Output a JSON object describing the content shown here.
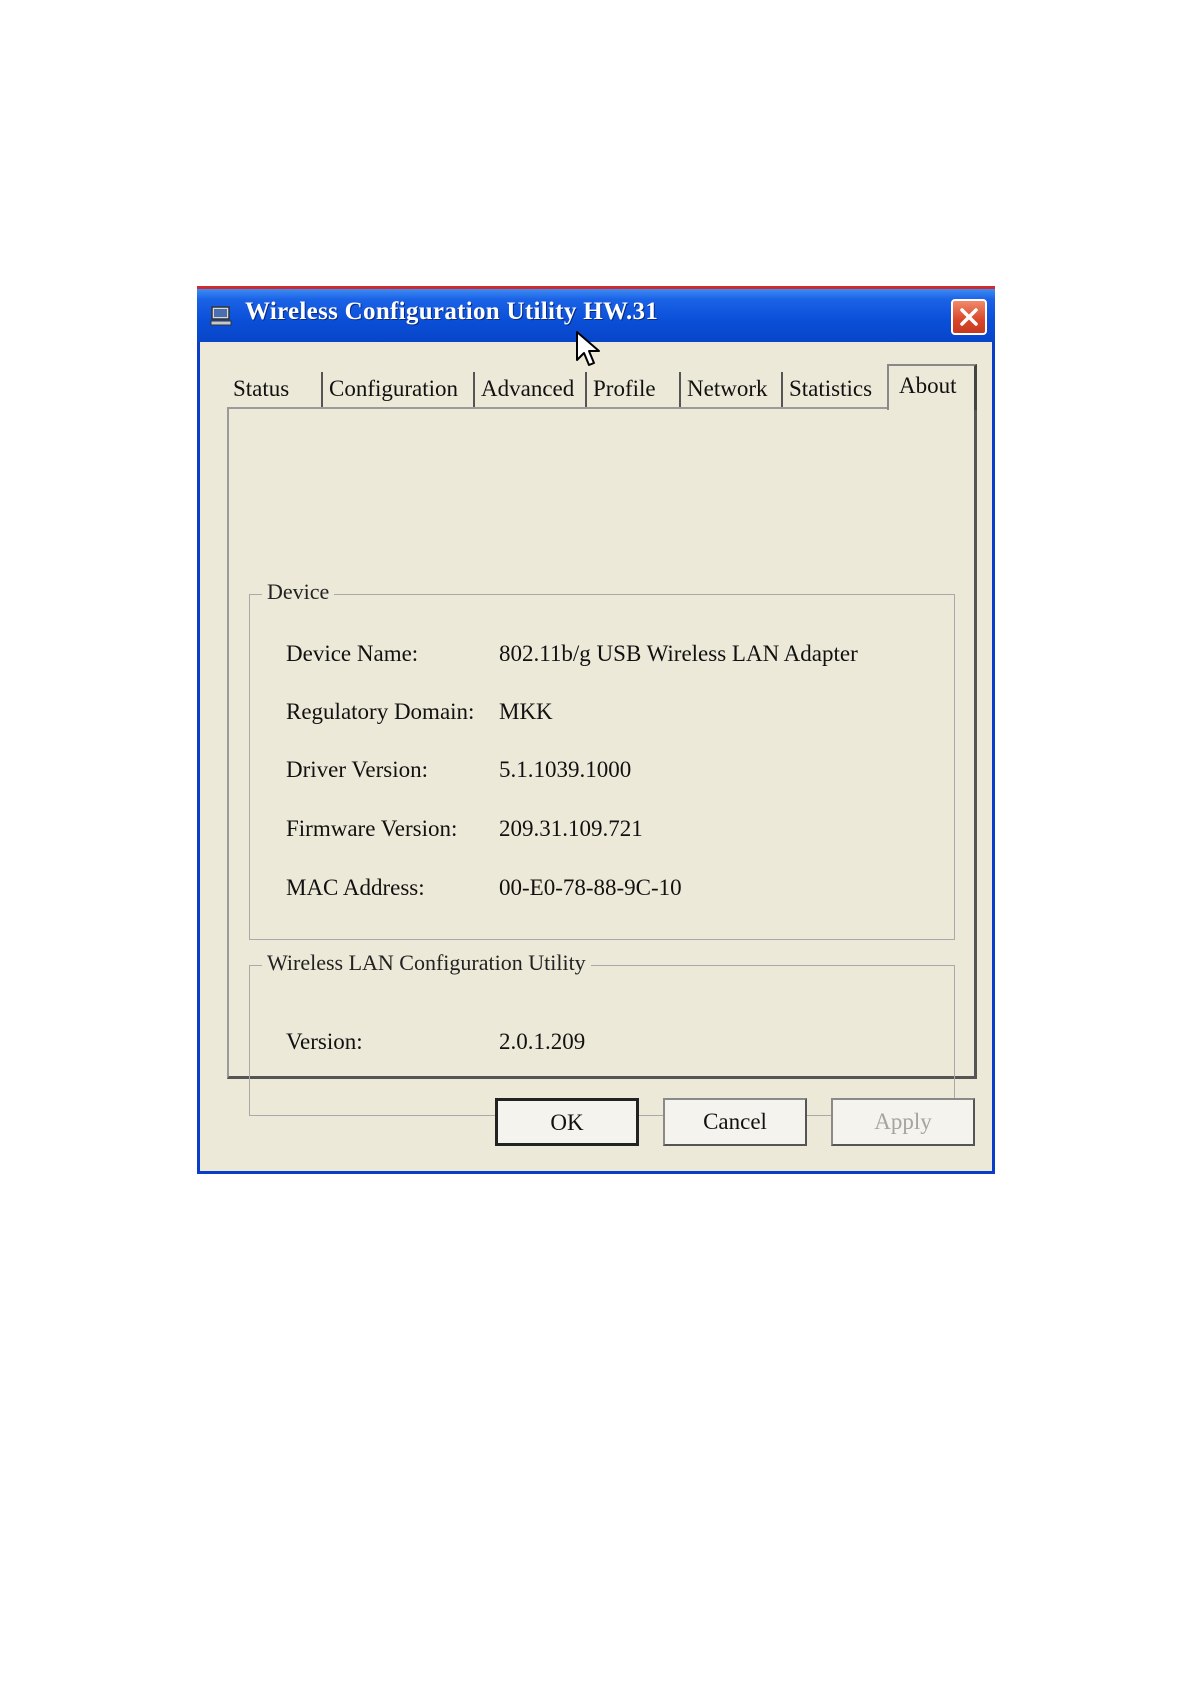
{
  "window": {
    "title": "Wireless Configuration Utility HW.31"
  },
  "tabs": [
    {
      "label": "Status"
    },
    {
      "label": "Configuration"
    },
    {
      "label": "Advanced"
    },
    {
      "label": "Profile"
    },
    {
      "label": "Network"
    },
    {
      "label": "Statistics"
    },
    {
      "label": "About",
      "active": true
    }
  ],
  "device_group": {
    "title": "Device",
    "rows": [
      {
        "label": "Device Name:",
        "value": "802.11b/g USB Wireless LAN Adapter"
      },
      {
        "label": "Regulatory Domain:",
        "value": "MKK"
      },
      {
        "label": "Driver Version:",
        "value": "5.1.1039.1000"
      },
      {
        "label": "Firmware Version:",
        "value": "209.31.109.721"
      },
      {
        "label": "MAC Address:",
        "value": "00-E0-78-88-9C-10"
      }
    ]
  },
  "utility_group": {
    "title": "Wireless LAN Configuration Utility",
    "rows": [
      {
        "label": "Version:",
        "value": "2.0.1.209"
      }
    ]
  },
  "buttons": {
    "ok": "OK",
    "cancel": "Cancel",
    "apply": "Apply"
  },
  "colors": {
    "titlebar": "#0a4fd8",
    "dialog_bg": "#ece9d8",
    "close_button": "#d9462a"
  },
  "icons": {
    "title_icon": "computer-monitor-icon",
    "close_icon": "close-icon",
    "cursor": "mouse-pointer-icon"
  }
}
